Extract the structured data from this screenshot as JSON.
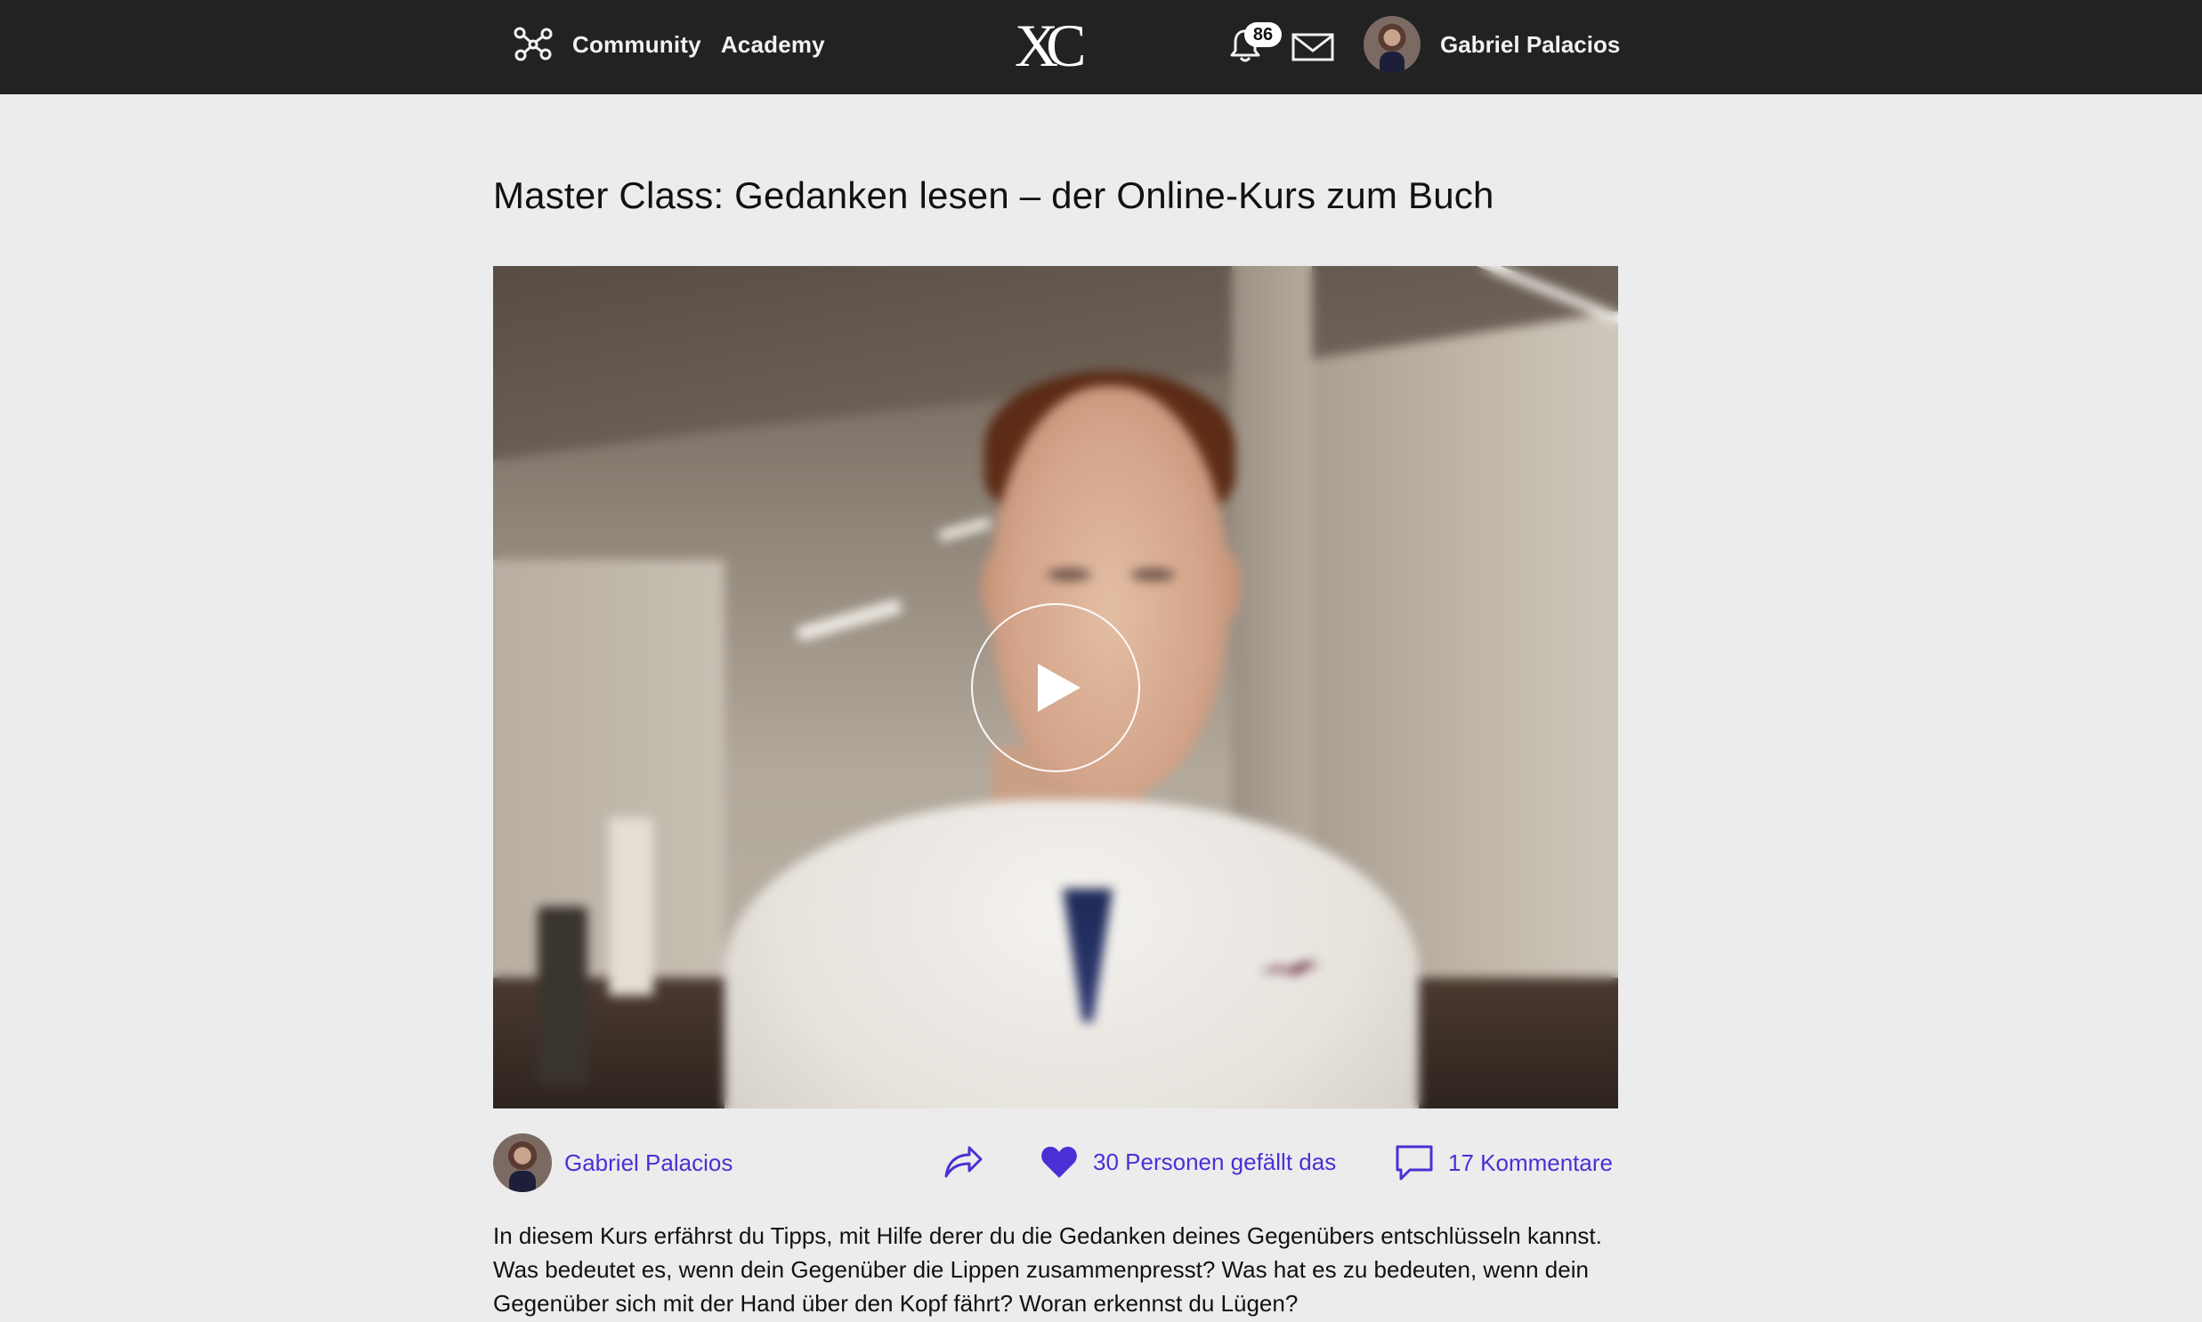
{
  "nav": {
    "community_label": "Community",
    "academy_label": "Academy",
    "logo_text": "XC",
    "notification_count": "86",
    "user_name": "Gabriel Palacios"
  },
  "post": {
    "title": "Master Class: Gedanken lesen – der Online-Kurs zum Buch",
    "author_name": "Gabriel Palacios",
    "likes_text": "30 Personen gefällt das",
    "comments_text": "17 Kommentare",
    "description": "In diesem Kurs erfährst du Tipps, mit Hilfe derer du die Gedanken deines Gegenübers entschlüsseln kannst. Was bedeutet es, wenn dein Gegenüber die Lippen zusammenpresst? Was hat es zu bedeuten, wenn dein Gegenüber sich mit der Hand über den Kopf fährt? Woran erkennst du Lügen?"
  },
  "colors": {
    "topbar": "#222222",
    "background": "#ececec",
    "accent": "#4b2fd6"
  },
  "icons": {
    "community": "network-nodes-icon",
    "notifications": "bell-icon",
    "messages": "mail-icon",
    "play": "play-icon",
    "share": "share-arrow-icon",
    "like": "heart-icon",
    "comments": "speech-bubble-icon"
  }
}
